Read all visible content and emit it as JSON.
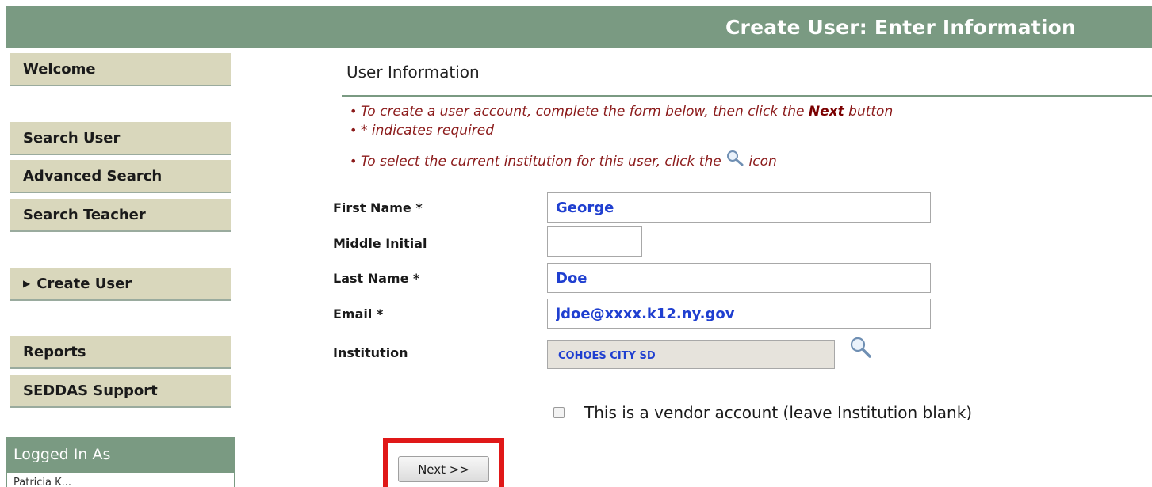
{
  "header": {
    "title": "Create User: Enter Information"
  },
  "sidebar": {
    "items": [
      {
        "label": "Welcome"
      },
      {
        "label": "Search User"
      },
      {
        "label": "Advanced Search"
      },
      {
        "label": "Search Teacher"
      },
      {
        "label": "Create User"
      },
      {
        "label": "Reports"
      },
      {
        "label": "SEDDAS Support"
      }
    ],
    "logged_in": {
      "title": "Logged In As",
      "user": "Patricia K..."
    }
  },
  "main": {
    "section_title": "User Information",
    "instructions": {
      "line1_pre": "To create a user account, complete the form below, then click the ",
      "line1_bold": "Next",
      "line1_post": " button",
      "line2": "* indicates required",
      "line3_pre": "To select the current institution for this user, click the ",
      "line3_post": " icon"
    },
    "form": {
      "first_name_label": "First Name *",
      "first_name_value": "George",
      "middle_initial_label": "Middle Initial",
      "middle_initial_value": "",
      "last_name_label": "Last Name *",
      "last_name_value": "Doe",
      "email_label": "Email *",
      "email_value": "jdoe@xxxx.k12.ny.gov",
      "institution_label": "Institution",
      "institution_value": "COHOES CITY SD",
      "vendor_label": "This is a vendor account (leave Institution blank)",
      "vendor_checked": false
    },
    "next_label": "Next >>"
  },
  "icons": {
    "search": "magnifier-icon",
    "nav_arrow": "caret-right-icon"
  },
  "colors": {
    "header": "#7a9a82",
    "nav": "#d9d7bc",
    "instruction_text": "#8b1a1a",
    "input_text": "#1f3fd0",
    "highlight": "#e01818"
  }
}
